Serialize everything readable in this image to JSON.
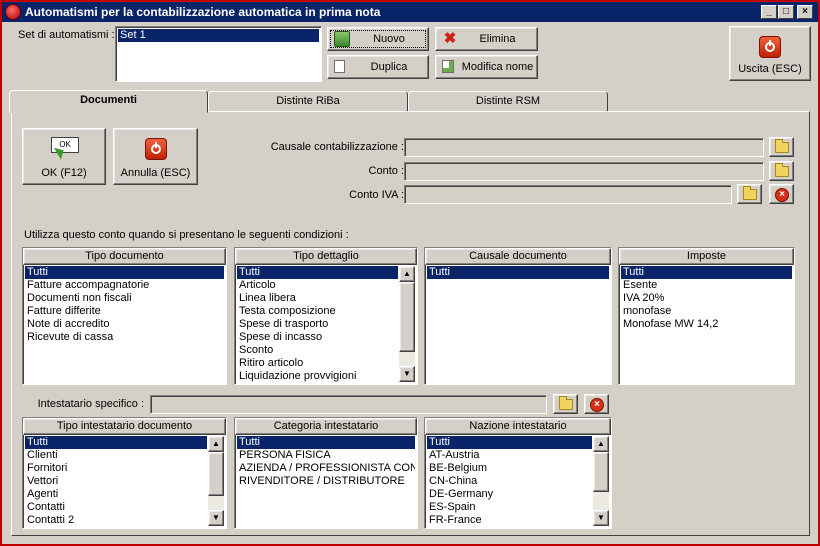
{
  "window": {
    "title": "Automatismi per la contabilizzazione automatica in prima nota",
    "controls": {
      "minimize": "_",
      "maximize": "□",
      "close": "×"
    }
  },
  "set": {
    "label": "Set di automatismi :",
    "items": [
      "Set 1"
    ],
    "selected": "Set 1"
  },
  "toolbar": {
    "new_label": "Nuovo",
    "delete_label": "Elimina",
    "duplicate_label": "Duplica",
    "rename_label": "Modifica nome",
    "exit_label": "Uscita (ESC)"
  },
  "tabs": [
    {
      "label": "Documenti",
      "active": true
    },
    {
      "label": "Distinte RiBa",
      "active": false
    },
    {
      "label": "Distinte RSM",
      "active": false
    }
  ],
  "actions": {
    "ok_label": "OK (F12)",
    "ok_icon_text": "OK",
    "cancel_label": "Annulla (ESC)"
  },
  "fields": {
    "causale_label": "Causale contabilizzazione :",
    "causale_value": "",
    "conto_label": "Conto :",
    "conto_value": "",
    "conto_iva_label": "Conto IVA :",
    "conto_iva_value": ""
  },
  "conditions_label": "Utilizza questo conto quando si presentano le seguenti condizioni :",
  "lists": {
    "tipo_documento": {
      "header": "Tipo documento",
      "items": [
        "Tutti",
        "Fatture accompagnatorie",
        "Documenti non fiscali",
        "Fatture differite",
        "Note di accredito",
        "Ricevute di cassa"
      ]
    },
    "tipo_dettaglio": {
      "header": "Tipo dettaglio",
      "items": [
        "Tutti",
        "Articolo",
        "Linea libera",
        "Testa composizione",
        "Spese di trasporto",
        "Spese di incasso",
        "Sconto",
        "Ritiro articolo",
        "Liquidazione provvigioni"
      ]
    },
    "causale_documento": {
      "header": "Causale documento",
      "items": [
        "Tutti"
      ]
    },
    "imposte": {
      "header": "Imposte",
      "items": [
        "Tutti",
        "Esente",
        "IVA 20%",
        "monofase",
        "Monofase MW 14,2"
      ]
    },
    "tipo_intestatario": {
      "header": "Tipo intestatario documento",
      "items": [
        "Tutti",
        "Clienti",
        "Fornitori",
        "Vettori",
        "Agenti",
        "Contatti",
        "Contatti 2"
      ]
    },
    "categoria_intestatario": {
      "header": "Categoria intestatario",
      "items": [
        "Tutti",
        "PERSONA FISICA",
        "AZIENDA / PROFESSIONISTA CON",
        "RIVENDITORE / DISTRIBUTORE"
      ]
    },
    "nazione_intestatario": {
      "header": "Nazione intestatario",
      "items": [
        "Tutti",
        "AT-Austria",
        "BE-Belgium",
        "CN-China",
        "DE-Germany",
        "ES-Spain",
        "FR-France"
      ]
    }
  },
  "intestatario": {
    "label": "Intestatario specifico :",
    "value": ""
  },
  "colors": {
    "titlebar": "#0a246a",
    "selection": "#0a246a",
    "face": "#d4d0c8",
    "window_border": "#c00000"
  }
}
